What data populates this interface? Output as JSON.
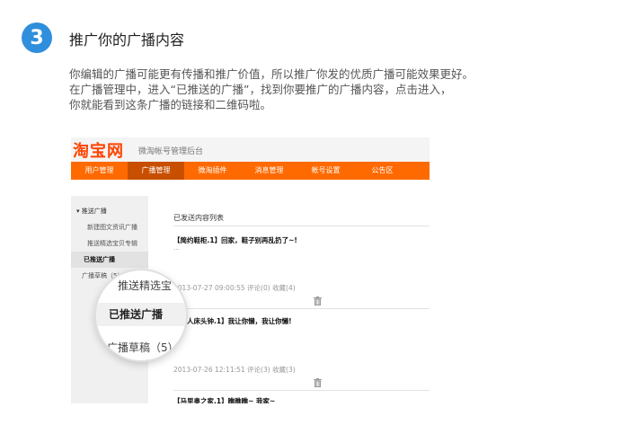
{
  "step_number": "3",
  "title": "推广你的广播内容",
  "description": [
    "你编辑的广播可能更有传播和推广价值，所以推广你发的优质广播可能效果更好。",
    "在广播管理中，进入“已推送的广播”，找到你要推广的广播内容，点击进入，",
    "你就能看到这条广播的链接和二维码啦。"
  ],
  "screenshot": {
    "logo": "淘宝网",
    "subtitle": "微淘帐号管理后台",
    "nav": [
      "用户管理",
      "广播管理",
      "微淘插件",
      "消息管理",
      "帐号设置",
      "公告区"
    ],
    "nav_active_index": 1,
    "sidebar": {
      "group": "▾ 推送广播",
      "items": [
        "新建图文资讯广播",
        "推送精选宝贝专辑",
        "已推送广播",
        "广播草稿（5）"
      ]
    },
    "main_title": "已发送内容列表",
    "posts": [
      {
        "title": "【简约鞋柜.1】回家，鞋子别再乱扔了~!",
        "excerpt": "...",
        "time": "2013-07-27 09:00:55",
        "comments": "评论(0)",
        "favorites": "收藏(4)"
      },
      {
        "title": "【懒人床头钟.1】我让你懒，我让你懒!",
        "time": "2013-07-26 12:11:51",
        "comments": "评论(3)",
        "favorites": "收藏(3)"
      },
      {
        "title": "【马里奥之家.1】瞧瞧瞧~ 我家~"
      }
    ],
    "magnifier": [
      "推送精选宝",
      "已推送广播",
      "广播草稿（5）"
    ]
  },
  "colors": {
    "accent": "#ff6a00",
    "badge": "#2f8fdc"
  }
}
